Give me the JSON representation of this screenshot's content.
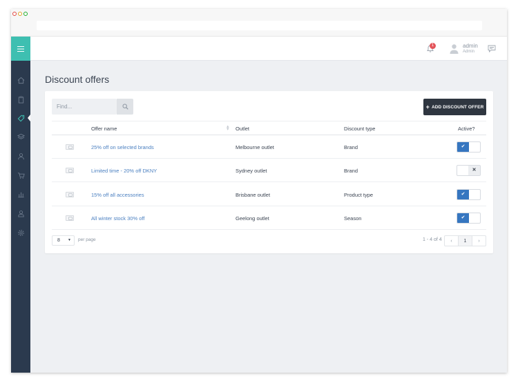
{
  "page": {
    "title": "Discount offers"
  },
  "topbar": {
    "notifications": "1",
    "user_name": "admin",
    "user_role": "Admin"
  },
  "toolbar": {
    "search_placeholder": "Find...",
    "add_button": "ADD DISCOUNT OFFER"
  },
  "table": {
    "columns": [
      "Offer name",
      "Outlet",
      "Discount type",
      "Active?"
    ],
    "rows": [
      {
        "name": "25% off on selected brands",
        "outlet": "Melbourne outlet",
        "type": "Brand",
        "active": true
      },
      {
        "name": "Limited time - 20% off DKNY",
        "outlet": "Sydney outlet",
        "type": "Brand",
        "active": false
      },
      {
        "name": "15% off all accessories",
        "outlet": "Brisbane outlet",
        "type": "Product type",
        "active": true
      },
      {
        "name": "All winter stock 30% off",
        "outlet": "Geelong outlet",
        "type": "Season",
        "active": true
      }
    ]
  },
  "pagination": {
    "page_size": "8",
    "per_page_label": "per page",
    "range": "1 - 4 of 4",
    "prev": "‹",
    "current": "1",
    "next": "›"
  },
  "colors": {
    "accent": "#3ebfb1",
    "sidebar": "#2b3a4e",
    "toggle_on": "#3676c0",
    "link": "#4a7fc0",
    "badge": "#e3545a"
  }
}
